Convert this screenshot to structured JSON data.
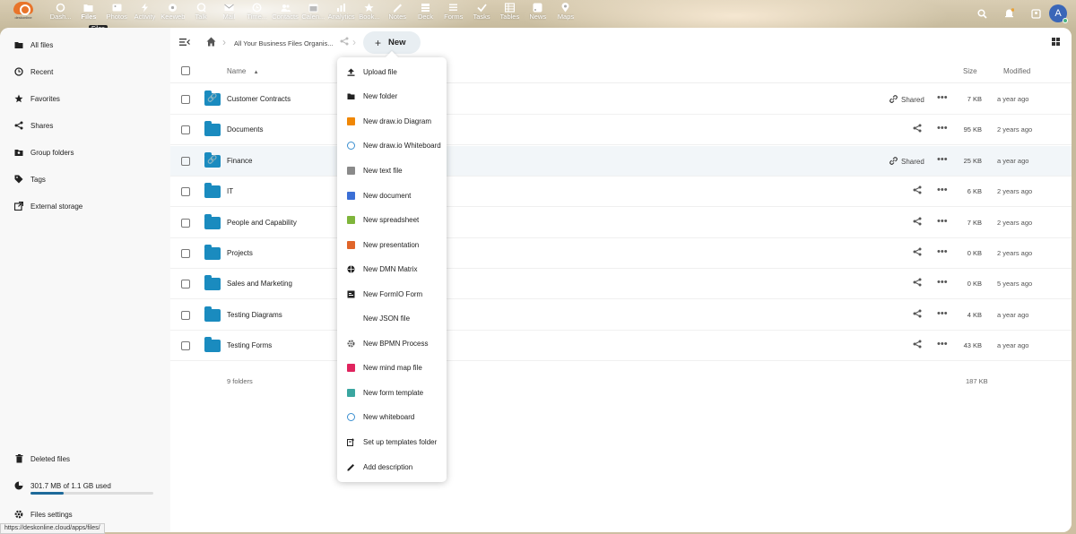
{
  "logo": {
    "text": "deskonline"
  },
  "apps": [
    {
      "label": "Dash...",
      "icon": "dashboard-icon",
      "active": false
    },
    {
      "label": "Files",
      "icon": "folder-icon",
      "active": true
    },
    {
      "label": "Photos",
      "icon": "image-icon",
      "active": false
    },
    {
      "label": "Activity",
      "icon": "lightning-icon",
      "active": false
    },
    {
      "label": "Keeweb",
      "icon": "key-icon",
      "active": false
    },
    {
      "label": "Talk",
      "icon": "chat-icon",
      "active": false
    },
    {
      "label": "Mail",
      "icon": "mail-icon",
      "active": false
    },
    {
      "label": "Time...",
      "icon": "clock-icon",
      "active": false
    },
    {
      "label": "Contacts",
      "icon": "contacts-icon",
      "active": false
    },
    {
      "label": "Calen...",
      "icon": "calendar-icon",
      "active": false
    },
    {
      "label": "Analytics",
      "icon": "chart-icon",
      "active": false
    },
    {
      "label": "Book...",
      "icon": "star-icon",
      "active": false
    },
    {
      "label": "Notes",
      "icon": "notes-icon",
      "active": false
    },
    {
      "label": "Deck",
      "icon": "deck-icon",
      "active": false
    },
    {
      "label": "Forms",
      "icon": "forms-icon",
      "active": false
    },
    {
      "label": "Tasks",
      "icon": "check-icon",
      "active": false
    },
    {
      "label": "Tables",
      "icon": "table-icon",
      "active": false
    },
    {
      "label": "News",
      "icon": "rss-icon",
      "active": false
    },
    {
      "label": "Maps",
      "icon": "map-pin-icon",
      "active": false
    }
  ],
  "tooltip": "Files",
  "user": {
    "avatar_letter": "A"
  },
  "sidebar": {
    "items": [
      {
        "label": "All files",
        "icon": "folder-icon"
      },
      {
        "label": "Recent",
        "icon": "clock-icon"
      },
      {
        "label": "Favorites",
        "icon": "star-icon"
      },
      {
        "label": "Shares",
        "icon": "share-icon"
      },
      {
        "label": "Group folders",
        "icon": "group-folder-icon"
      },
      {
        "label": "Tags",
        "icon": "tag-icon"
      },
      {
        "label": "External storage",
        "icon": "external-link-icon"
      }
    ],
    "deleted": "Deleted files",
    "quota": "301.7 MB of 1.1 GB used",
    "quota_fraction": 0.27,
    "settings": "Files settings"
  },
  "breadcrumb": {
    "path": "All Your Business Files Organis...",
    "new_button": "New"
  },
  "table": {
    "headers": {
      "name": "Name",
      "size": "Size",
      "modified": "Modified"
    },
    "rows": [
      {
        "name": "Customer Contracts",
        "shared": "Shared",
        "size": "7 KB",
        "modified": "a year ago",
        "linked": true
      },
      {
        "name": "Documents",
        "shared": "",
        "size": "95 KB",
        "modified": "2 years ago",
        "linked": false
      },
      {
        "name": "Finance",
        "shared": "Shared",
        "size": "25 KB",
        "modified": "a year ago",
        "linked": true
      },
      {
        "name": "IT",
        "shared": "",
        "size": "6 KB",
        "modified": "2 years ago",
        "linked": false
      },
      {
        "name": "People and Capability",
        "shared": "",
        "size": "7 KB",
        "modified": "2 years ago",
        "linked": false
      },
      {
        "name": "Projects",
        "shared": "",
        "size": "0 KB",
        "modified": "2 years ago",
        "linked": false
      },
      {
        "name": "Sales and Marketing",
        "shared": "",
        "size": "0 KB",
        "modified": "5 years ago",
        "linked": false
      },
      {
        "name": "Testing Diagrams",
        "shared": "",
        "size": "4 KB",
        "modified": "a year ago",
        "linked": false
      },
      {
        "name": "Testing Forms",
        "shared": "",
        "size": "43 KB",
        "modified": "a year ago",
        "linked": false
      }
    ],
    "summary_count": "9 folders",
    "summary_size": "187 KB"
  },
  "new_menu": [
    {
      "label": "Upload file",
      "icon": "upload-icon",
      "color": "#222222"
    },
    {
      "label": "New folder",
      "icon": "folder-icon",
      "color": "#222222"
    },
    {
      "label": "New draw.io Diagram",
      "icon": "drawio-icon",
      "color": "#f08705"
    },
    {
      "label": "New draw.io Whiteboard",
      "icon": "whiteboard-icon",
      "color": "#3a8fd0"
    },
    {
      "label": "New text file",
      "icon": "text-file-icon",
      "color": "#8a8a8a"
    },
    {
      "label": "New document",
      "icon": "document-icon",
      "color": "#3b6fd6"
    },
    {
      "label": "New spreadsheet",
      "icon": "spreadsheet-icon",
      "color": "#7fb53b"
    },
    {
      "label": "New presentation",
      "icon": "presentation-icon",
      "color": "#e0652a"
    },
    {
      "label": "New DMN Matrix",
      "icon": "dmn-icon",
      "color": "#222222"
    },
    {
      "label": "New FormIO Form",
      "icon": "form-icon",
      "color": "#222222"
    },
    {
      "label": "New JSON file",
      "icon": "json-icon",
      "color": "#ffffff"
    },
    {
      "label": "New BPMN Process",
      "icon": "gear-icon",
      "color": "#555555"
    },
    {
      "label": "New mind map file",
      "icon": "mindmap-icon",
      "color": "#e0245e"
    },
    {
      "label": "New form template",
      "icon": "form-template-icon",
      "color": "#3aa6a0"
    },
    {
      "label": "New whiteboard",
      "icon": "whiteboard-icon",
      "color": "#3a8fd0"
    },
    {
      "label": "Set up templates folder",
      "icon": "template-folder-icon",
      "color": "#222222"
    },
    {
      "label": "Add description",
      "icon": "pencil-icon",
      "color": "#222222"
    }
  ],
  "status_url": "https://deskonline.cloud/apps/files/"
}
